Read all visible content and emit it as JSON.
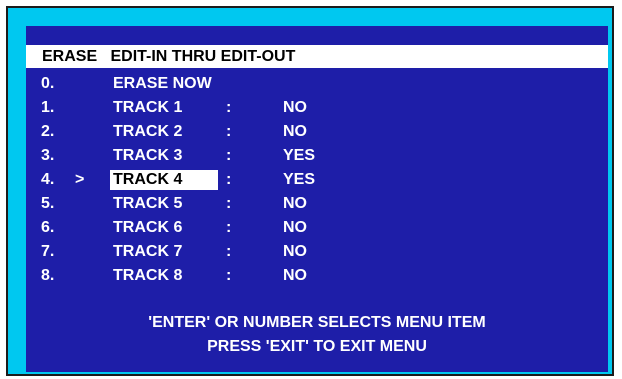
{
  "title": "ERASE   EDIT-IN THRU EDIT-OUT",
  "separator": ":",
  "cursor": ">",
  "selected_index": 4,
  "menu": [
    {
      "num": "0.",
      "label": "ERASE NOW",
      "value": ""
    },
    {
      "num": "1.",
      "label": "TRACK 1",
      "value": "NO"
    },
    {
      "num": "2.",
      "label": "TRACK 2",
      "value": "NO"
    },
    {
      "num": "3.",
      "label": "TRACK 3",
      "value": "YES"
    },
    {
      "num": "4.",
      "label": "TRACK 4",
      "value": "YES"
    },
    {
      "num": "5.",
      "label": "TRACK 5",
      "value": "NO"
    },
    {
      "num": "6.",
      "label": "TRACK 6",
      "value": "NO"
    },
    {
      "num": "7.",
      "label": "TRACK 7",
      "value": "NO"
    },
    {
      "num": "8.",
      "label": "TRACK 8",
      "value": "NO"
    }
  ],
  "footer": {
    "line1": "'ENTER' OR NUMBER SELECTS MENU ITEM",
    "line2": "PRESS 'EXIT' TO EXIT MENU"
  },
  "colors": {
    "frame": "#00c8f0",
    "screen": "#1e1ea8",
    "text": "#ffffff",
    "highlight": "#ffffff"
  }
}
